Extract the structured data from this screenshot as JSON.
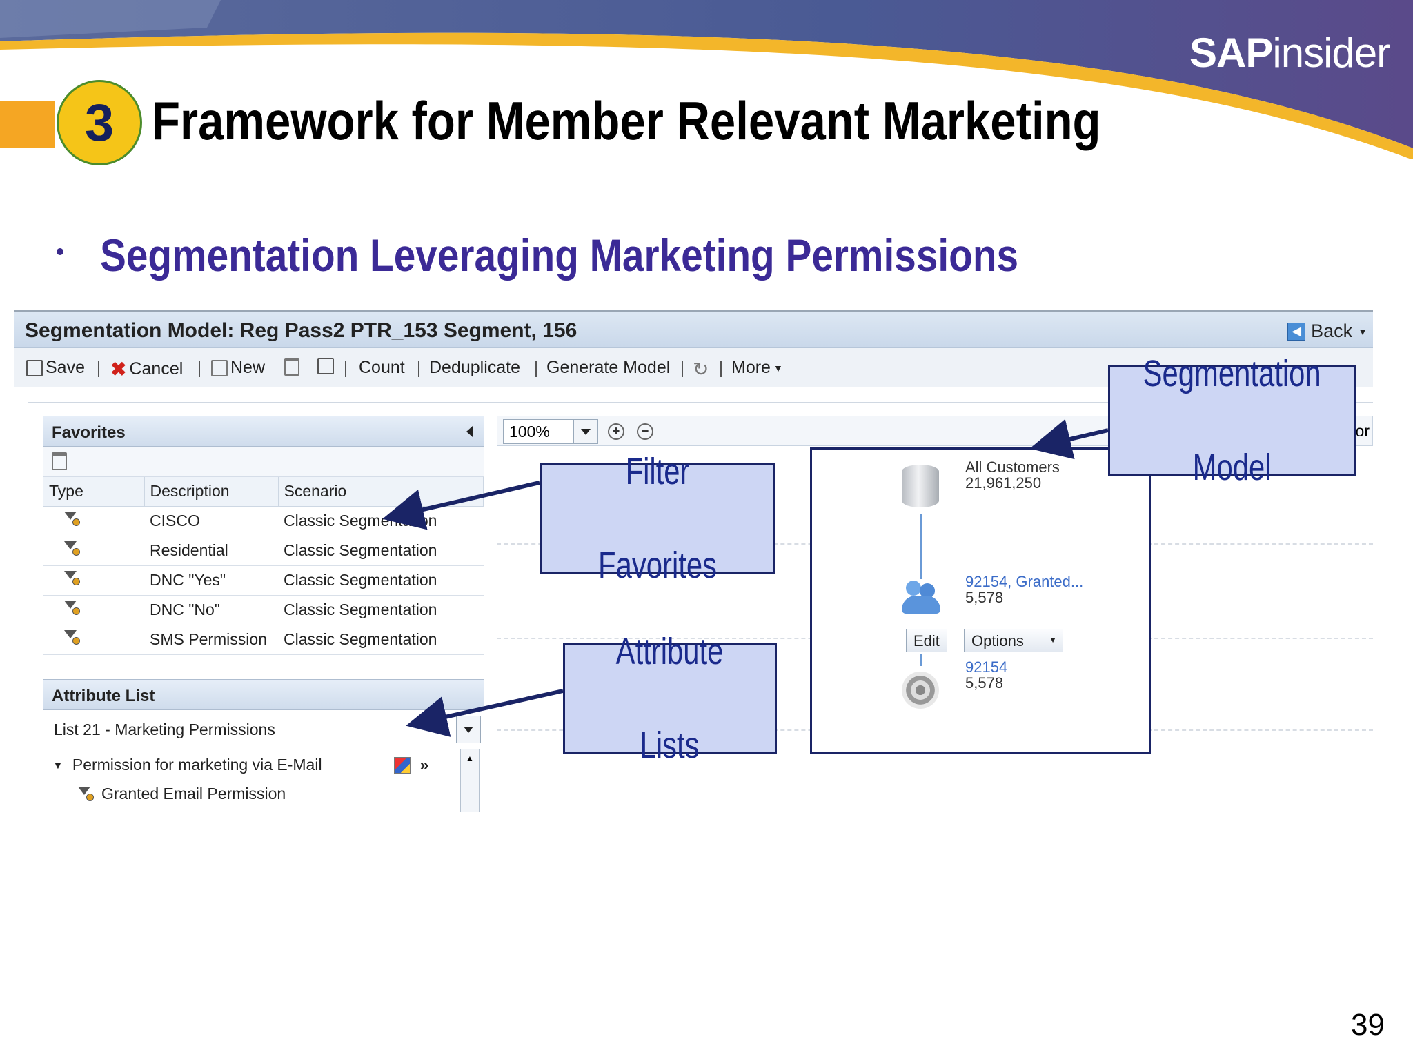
{
  "brand": {
    "bold": "SAP",
    "rest": "insider"
  },
  "slide": {
    "number": "3",
    "title": "Framework for Member Relevant Marketing",
    "subtitle": "Segmentation Leveraging Marketing Permissions",
    "page_number": "39"
  },
  "colors": {
    "accent_orange": "#f5a623",
    "title_purple": "#3b2a96",
    "callout_fill": "#cdd6f4",
    "callout_border": "#1a2466"
  },
  "app": {
    "title": "Segmentation Model: Reg Pass2 PTR_153 Segment, 156",
    "back_label": "Back",
    "toolbar": {
      "save": "Save",
      "cancel": "Cancel",
      "new": "New",
      "count": "Count",
      "deduplicate": "Deduplicate",
      "generate_model": "Generate Model",
      "more": "More"
    },
    "favorites": {
      "title": "Favorites",
      "columns": [
        "Type",
        "Description",
        "Scenario"
      ],
      "rows": [
        {
          "description": "CISCO",
          "scenario": "Classic Segmentation"
        },
        {
          "description": "Residential",
          "scenario": "Classic Segmentation"
        },
        {
          "description": "DNC \"Yes\"",
          "scenario": "Classic Segmentation"
        },
        {
          "description": "DNC \"No\"",
          "scenario": "Classic Segmentation"
        },
        {
          "description": "SMS Permission",
          "scenario": "Classic Segmentation"
        }
      ]
    },
    "attribute_list": {
      "title": "Attribute List",
      "selected": "List 21 - Marketing Permissions",
      "tree": [
        {
          "label": "Permission for marketing via  E-Mail"
        },
        {
          "label": "Granted Email Permission"
        }
      ]
    },
    "canvas": {
      "zoom": "100%",
      "partial_label": "tor",
      "nodes": [
        {
          "name": "All Customers",
          "count": "21,961,250"
        },
        {
          "name": "92154, Granted...",
          "count": "5,578"
        },
        {
          "name": "92154",
          "count": "5,578"
        }
      ],
      "edit_label": "Edit",
      "options_label": "Options"
    }
  },
  "callouts": {
    "segmentation_model": [
      "Segmentation",
      "Model"
    ],
    "filter_favorites": [
      "Filter",
      "Favorites"
    ],
    "attribute_lists": [
      "Attribute",
      "Lists"
    ]
  }
}
